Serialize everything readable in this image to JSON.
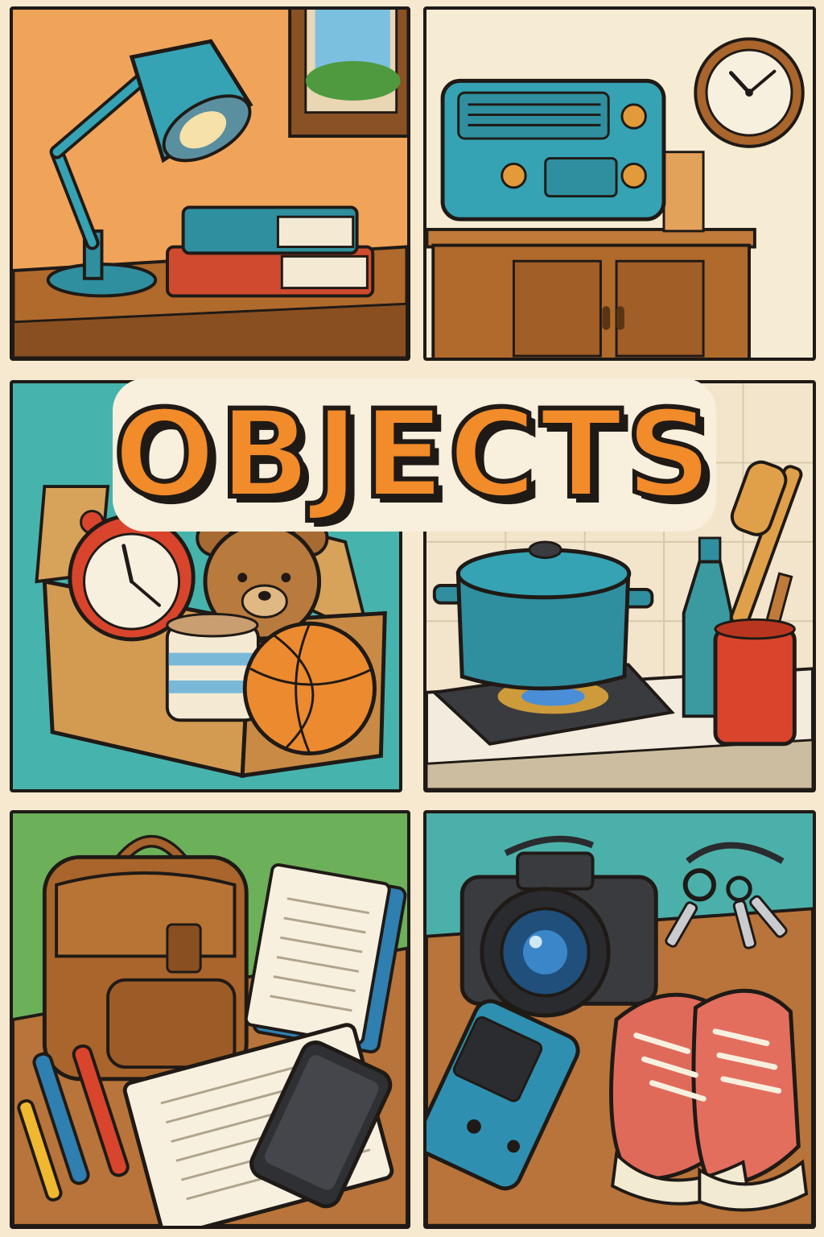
{
  "title": "OBJECTS",
  "palette": {
    "background": "#f6e9cf",
    "orange": "#f28b2a",
    "teal": "#3aa6a6",
    "outline": "#1f1a16",
    "wood": "#b06a2c"
  },
  "panels": [
    {
      "scene": "desk",
      "items": [
        "lamp-icon",
        "books-icon",
        "picture-frame-icon"
      ]
    },
    {
      "scene": "cabinet",
      "items": [
        "radio-icon",
        "wall-clock-icon",
        "cabinet-icon"
      ]
    },
    {
      "scene": "box",
      "items": [
        "alarm-clock-icon",
        "teddy-bear-icon",
        "mug-icon",
        "basketball-icon",
        "cardboard-box-icon"
      ]
    },
    {
      "scene": "kitchen",
      "items": [
        "cooking-pot-icon",
        "stove-icon",
        "bottle-icon",
        "utensil-holder-icon"
      ]
    },
    {
      "scene": "school",
      "items": [
        "backpack-icon",
        "notepad-icon",
        "notebook-icon",
        "pens-icon",
        "smartphone-icon"
      ]
    },
    {
      "scene": "leisure",
      "items": [
        "camera-icon",
        "keys-icon",
        "game-console-icon",
        "sneakers-icon"
      ]
    }
  ]
}
